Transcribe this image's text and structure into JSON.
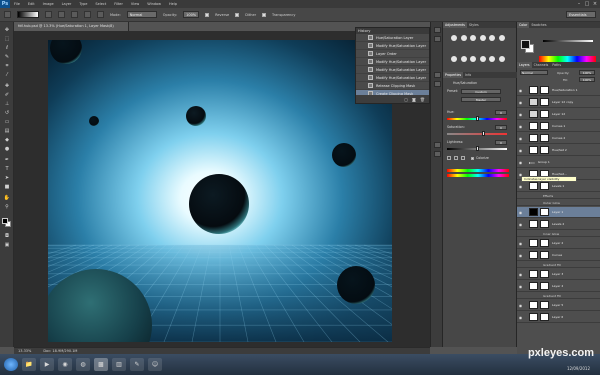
{
  "app": {
    "logo": "Ps"
  },
  "menu": [
    "File",
    "Edit",
    "Image",
    "Layer",
    "Type",
    "Select",
    "Filter",
    "View",
    "Window",
    "Help"
  ],
  "options_bar": {
    "mode_label": "Mode:",
    "mode_value": "Normal",
    "opacity_label": "Opacity:",
    "opacity_value": "100%",
    "reverse_label": "Reverse",
    "dither_label": "Dither",
    "transparency_label": "Transparency",
    "workspace": "Essentials"
  },
  "document": {
    "tab_title": "fdf-hub.psd @ 13.3% (Hue/Saturation 1, Layer Mask/8)",
    "zoom": "13.33%",
    "doc_size": "Doc: 18.9M/290.1M"
  },
  "history": {
    "title": "History",
    "items": [
      {
        "label": "Hue/Saturation Layer",
        "icon": "adjustment-icon"
      },
      {
        "label": "Modify Hue/Saturation Layer",
        "icon": "adjustment-icon"
      },
      {
        "label": "Layer Order",
        "icon": "layer-order-icon"
      },
      {
        "label": "Modify Hue/Saturation Layer",
        "icon": "adjustment-icon"
      },
      {
        "label": "Modify Hue/Saturation Layer",
        "icon": "adjustment-icon"
      },
      {
        "label": "Modify Hue/Saturation Layer",
        "icon": "adjustment-icon"
      },
      {
        "label": "Release Clipping Mask",
        "icon": "clipping-icon"
      },
      {
        "label": "Create Clipping Mask",
        "icon": "clipping-icon",
        "selected": true
      }
    ]
  },
  "mid_panels": {
    "top_tabs": [
      "Adjustments",
      "Styles"
    ],
    "props_tabs": [
      "Properties",
      "Info"
    ],
    "props_title": "Hue/Saturation",
    "preset_label": "Preset:",
    "preset_value": "Custom",
    "channel_value": "Master",
    "hue_label": "Hue:",
    "hue_value": "0",
    "saturation_label": "Saturation:",
    "saturation_value": "0",
    "lightness_label": "Lightness:",
    "lightness_value": "0",
    "colorize_label": "Colorize",
    "hue_level": 0.5,
    "saturation_level": 0.62,
    "lightness_level": 0.5
  },
  "right_panels": {
    "color_tabs": [
      "Color",
      "Swatches"
    ],
    "layer_tabs": [
      "Layers",
      "Channels",
      "Paths"
    ],
    "blend_mode": "Normal",
    "opacity_label": "Opacity:",
    "opacity_value": "100%",
    "fill_label": "Fill:",
    "fill_value": "100%",
    "tooltip": "Indicates layer visibility",
    "layers": [
      {
        "name": "Hue/Saturation 1",
        "thumb": "white"
      },
      {
        "name": "Layer 12 copy",
        "thumb": "ghost",
        "fx": true
      },
      {
        "name": "Layer 12",
        "thumb": "ghost"
      },
      {
        "name": "Curves 1",
        "thumb": "white"
      },
      {
        "name": "Curves 2",
        "thumb": "white"
      },
      {
        "name": "Hue/Sat 2",
        "thumb": "white"
      },
      {
        "name": "Group 1",
        "thumb": "none"
      },
      {
        "name": "Hue/Sat...",
        "thumb": "white"
      },
      {
        "name": "Levels 1",
        "thumb": "white"
      },
      {
        "name": "Effects",
        "thumb": "none",
        "sub": true
      },
      {
        "name": "Outer Glow",
        "thumb": "none",
        "sub": true
      },
      {
        "name": "Layer 1",
        "thumb": "white",
        "selected": true
      },
      {
        "name": "Levels 2",
        "thumb": "white"
      },
      {
        "name": "Inner Glow",
        "thumb": "none",
        "sub": true
      },
      {
        "name": "Layer 2",
        "thumb": "white"
      },
      {
        "name": "Curves",
        "thumb": "white"
      },
      {
        "name": "Gradient Fill",
        "thumb": "none",
        "sub": true
      },
      {
        "name": "Layer 3",
        "thumb": "white"
      },
      {
        "name": "Layer 4",
        "thumb": "white"
      },
      {
        "name": "Gradient Fill",
        "thumb": "none",
        "sub": true
      },
      {
        "name": "Layer 5",
        "thumb": "white"
      },
      {
        "name": "Layer 6",
        "thumb": "white"
      }
    ]
  },
  "watermark": {
    "site": "pxleyes.com",
    "date": "12/09/2012"
  },
  "colors": {
    "accent": "#6b7f99",
    "panel": "#474747",
    "canvas_glow": "#dff6ff",
    "deep_blue": "#0a2436"
  }
}
